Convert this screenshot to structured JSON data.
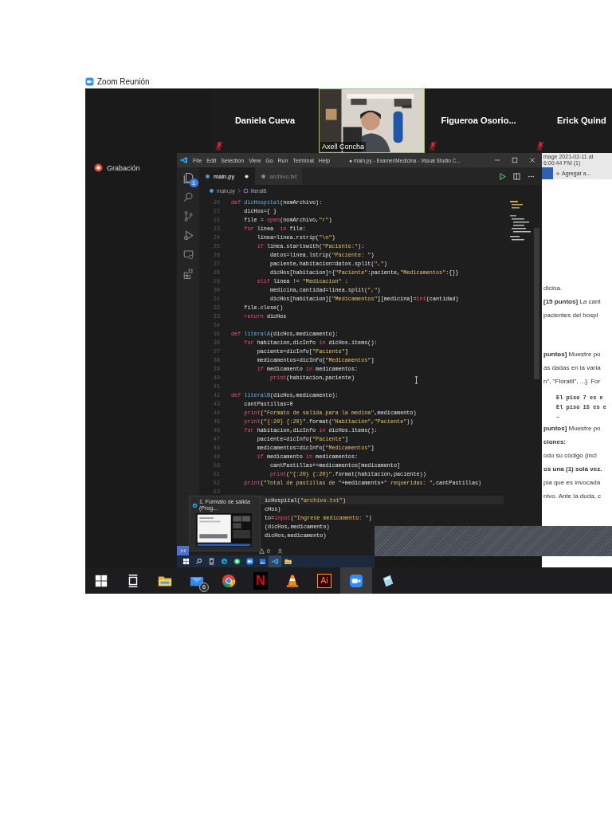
{
  "window": {
    "title": "Zoom Reunión"
  },
  "participants": [
    {
      "name": "Daniela Cueva",
      "kind": "name",
      "muted": true
    },
    {
      "name": "Axell Concha",
      "kind": "video"
    },
    {
      "name": "Figueroa  Osorio...",
      "kind": "name",
      "muted": true
    },
    {
      "name": "Erick Quind",
      "kind": "name",
      "muted": true
    }
  ],
  "recording": {
    "label": "Grabación"
  },
  "editor": {
    "menu": [
      "File",
      "Edit",
      "Selection",
      "View",
      "Go",
      "Run",
      "Terminal",
      "Help"
    ],
    "title": "● main.py - ExamenMedicina - Visual Studio C...",
    "explorer_badge": "1",
    "tabs": [
      {
        "label": "main.py",
        "selected": true,
        "modified": true
      },
      {
        "label": "archivo.txt",
        "selected": false,
        "modified": false
      }
    ],
    "breadcrumb": [
      "main.py",
      "literalB"
    ],
    "lines": [
      {
        "number": "20",
        "tokens": [
          {
            "kind": "kw",
            "text": "def "
          },
          {
            "kind": "fn",
            "text": "dicHospital"
          },
          {
            "kind": "txt",
            "text": "(nomArchivo):"
          }
        ]
      },
      {
        "number": "21",
        "tokens": [
          {
            "kind": "txt",
            "text": "    dicHos={ }"
          }
        ]
      },
      {
        "number": "22",
        "tokens": [
          {
            "kind": "txt",
            "text": "    file = "
          },
          {
            "kind": "kw",
            "text": "open"
          },
          {
            "kind": "txt",
            "text": "(nomArchivo,"
          },
          {
            "kind": "str",
            "text": "\"r\""
          },
          {
            "kind": "txt",
            "text": ")"
          }
        ]
      },
      {
        "number": "23",
        "tokens": [
          {
            "kind": "kw",
            "text": "    for "
          },
          {
            "kind": "txt",
            "text": "linea  "
          },
          {
            "kind": "kw",
            "text": "in "
          },
          {
            "kind": "txt",
            "text": "file:"
          }
        ]
      },
      {
        "number": "24",
        "tokens": [
          {
            "kind": "txt",
            "text": "        linea=linea.rstrip("
          },
          {
            "kind": "str",
            "text": "\"\\n\""
          },
          {
            "kind": "txt",
            "text": ")"
          }
        ]
      },
      {
        "number": "25",
        "tokens": [
          {
            "kind": "kw",
            "text": "        if "
          },
          {
            "kind": "txt",
            "text": "linea.startswith("
          },
          {
            "kind": "str",
            "text": "\"Paciente:\""
          },
          {
            "kind": "txt",
            "text": "):"
          }
        ]
      },
      {
        "number": "26",
        "tokens": [
          {
            "kind": "txt",
            "text": "            datos=linea.lstrip("
          },
          {
            "kind": "str",
            "text": "\"Paciente: \""
          },
          {
            "kind": "txt",
            "text": ")"
          }
        ]
      },
      {
        "number": "27",
        "tokens": [
          {
            "kind": "txt",
            "text": "            paciente,habitacion=datos.split("
          },
          {
            "kind": "str",
            "text": "\",\""
          },
          {
            "kind": "txt",
            "text": ")"
          }
        ]
      },
      {
        "number": "28",
        "tokens": [
          {
            "kind": "txt",
            "text": "            dicHos[habitacion]={"
          },
          {
            "kind": "str",
            "text": "\"Paciente\""
          },
          {
            "kind": "txt",
            "text": ":paciente,"
          },
          {
            "kind": "str",
            "text": "\"Medicamentos\""
          },
          {
            "kind": "txt",
            "text": ":{}}"
          }
        ]
      },
      {
        "number": "29",
        "tokens": [
          {
            "kind": "kw",
            "text": "        elif "
          },
          {
            "kind": "txt",
            "text": "linea != "
          },
          {
            "kind": "str",
            "text": "\"Medicacion\""
          },
          {
            "kind": "txt",
            "text": " :"
          }
        ]
      },
      {
        "number": "30",
        "tokens": [
          {
            "kind": "txt",
            "text": "            medicina,cantidad=linea.split("
          },
          {
            "kind": "str",
            "text": "\",\""
          },
          {
            "kind": "txt",
            "text": ")"
          }
        ]
      },
      {
        "number": "31",
        "tokens": [
          {
            "kind": "txt",
            "text": "            dicHos[habitacion]["
          },
          {
            "kind": "str",
            "text": "\"Medicamentos\""
          },
          {
            "kind": "txt",
            "text": "][medicina]="
          },
          {
            "kind": "kw",
            "text": "int"
          },
          {
            "kind": "txt",
            "text": "(cantidad)"
          }
        ]
      },
      {
        "number": "32",
        "tokens": [
          {
            "kind": "txt",
            "text": "    file.close()"
          }
        ]
      },
      {
        "number": "33",
        "tokens": [
          {
            "kind": "kw",
            "text": "    return "
          },
          {
            "kind": "txt",
            "text": "dicHos"
          }
        ]
      },
      {
        "number": "34"
      },
      {
        "number": "35",
        "tokens": [
          {
            "kind": "kw",
            "text": "def "
          },
          {
            "kind": "fn",
            "text": "literalA"
          },
          {
            "kind": "txt",
            "text": "(dicHos,medicamento):"
          }
        ]
      },
      {
        "number": "36",
        "tokens": [
          {
            "kind": "kw",
            "text": "    for "
          },
          {
            "kind": "txt",
            "text": "habitacion,dicInfo "
          },
          {
            "kind": "kw",
            "text": "in "
          },
          {
            "kind": "txt",
            "text": "dicHos.items():"
          }
        ]
      },
      {
        "number": "37",
        "tokens": [
          {
            "kind": "txt",
            "text": "        paciente=dicInfo["
          },
          {
            "kind": "str",
            "text": "\"Paciente\""
          },
          {
            "kind": "txt",
            "text": "]"
          }
        ]
      },
      {
        "number": "38",
        "tokens": [
          {
            "kind": "txt",
            "text": "        medicamentos=dicInfo["
          },
          {
            "kind": "str",
            "text": "\"Medicamentos\""
          },
          {
            "kind": "txt",
            "text": "]"
          }
        ]
      },
      {
        "number": "39",
        "tokens": [
          {
            "kind": "kw",
            "text": "        if "
          },
          {
            "kind": "txt",
            "text": "medicamento "
          },
          {
            "kind": "kw",
            "text": "in "
          },
          {
            "kind": "txt",
            "text": "medicamentos:"
          }
        ]
      },
      {
        "number": "40",
        "tokens": [
          {
            "kind": "kw",
            "text": "            print"
          },
          {
            "kind": "txt",
            "text": "(habitacion,paciente)"
          }
        ]
      },
      {
        "number": "41"
      },
      {
        "number": "42",
        "tokens": [
          {
            "kind": "kw",
            "text": "def "
          },
          {
            "kind": "fn",
            "text": "literalB"
          },
          {
            "kind": "txt",
            "text": "(dicHos,medicamento):"
          }
        ]
      },
      {
        "number": "43",
        "tokens": [
          {
            "kind": "txt",
            "text": "    cantPastillas=0"
          }
        ]
      },
      {
        "number": "44",
        "tokens": [
          {
            "kind": "kw",
            "text": "    print"
          },
          {
            "kind": "txt",
            "text": "("
          },
          {
            "kind": "str",
            "text": "\"Formato de salida para la medina\""
          },
          {
            "kind": "txt",
            "text": ",medicamento)"
          }
        ]
      },
      {
        "number": "45",
        "tokens": [
          {
            "kind": "kw",
            "text": "    print"
          },
          {
            "kind": "txt",
            "text": "("
          },
          {
            "kind": "str",
            "text": "\"{:20} {:20}\""
          },
          {
            "kind": "txt",
            "text": ".format("
          },
          {
            "kind": "str",
            "text": "\"Habitación\""
          },
          {
            "kind": "txt",
            "text": ","
          },
          {
            "kind": "str",
            "text": "\"Paciente\""
          },
          {
            "kind": "txt",
            "text": "))"
          }
        ]
      },
      {
        "number": "46",
        "tokens": [
          {
            "kind": "kw",
            "text": "    for "
          },
          {
            "kind": "txt",
            "text": "habitacion,dicInfo "
          },
          {
            "kind": "kw",
            "text": "in "
          },
          {
            "kind": "txt",
            "text": "dicHos.items():"
          }
        ]
      },
      {
        "number": "47",
        "tokens": [
          {
            "kind": "txt",
            "text": "        paciente=dicInfo["
          },
          {
            "kind": "str",
            "text": "\"Paciente\""
          },
          {
            "kind": "txt",
            "text": "]"
          }
        ]
      },
      {
        "number": "48",
        "tokens": [
          {
            "kind": "txt",
            "text": "        medicamentos=dicInfo["
          },
          {
            "kind": "str",
            "text": "\"Medicamentos\""
          },
          {
            "kind": "txt",
            "text": "]"
          }
        ]
      },
      {
        "number": "49",
        "tokens": [
          {
            "kind": "kw",
            "text": "        if "
          },
          {
            "kind": "txt",
            "text": "medicamento "
          },
          {
            "kind": "kw",
            "text": "in "
          },
          {
            "kind": "txt",
            "text": "medicamentos:"
          }
        ]
      },
      {
        "number": "50",
        "tokens": [
          {
            "kind": "txt",
            "text": "            cantPastillas+=medicamentos[medicamento]"
          }
        ]
      },
      {
        "number": "51",
        "tokens": [
          {
            "kind": "kw",
            "text": "            print"
          },
          {
            "kind": "txt",
            "text": "("
          },
          {
            "kind": "str",
            "text": "\"{:20} {:20}\""
          },
          {
            "kind": "txt",
            "text": ".format(habitacion,paciente))"
          }
        ]
      },
      {
        "number": "52",
        "tokens": [
          {
            "kind": "kw",
            "text": "    print"
          },
          {
            "kind": "txt",
            "text": "("
          },
          {
            "kind": "str",
            "text": "\"Total de pastillas de \""
          },
          {
            "kind": "txt",
            "text": "+medicamento+"
          },
          {
            "kind": "str",
            "text": "\" requeridas: \""
          },
          {
            "kind": "txt",
            "text": ",cantPastillas)"
          }
        ]
      },
      {
        "number": "53"
      }
    ],
    "covered_lines": [
      {
        "current": true,
        "tokens": [
          {
            "kind": "txt",
            "text": "icHospital("
          },
          {
            "kind": "str",
            "text": "\"archivo.txt\""
          },
          {
            "kind": "txt",
            "text": ")"
          }
        ]
      },
      {
        "current": false,
        "tokens": [
          {
            "kind": "txt",
            "text": "cHos)"
          }
        ]
      },
      {
        "current": false,
        "tokens": [
          {
            "kind": "txt",
            "text": "to="
          },
          {
            "kind": "kw",
            "text": "input"
          },
          {
            "kind": "txt",
            "text": "("
          },
          {
            "kind": "str",
            "text": "\"Ingrese medicamento: \""
          },
          {
            "kind": "txt",
            "text": ")"
          }
        ]
      },
      {
        "current": false,
        "tokens": [
          {
            "kind": "txt",
            "text": "(dicHos,medicamento)"
          }
        ]
      },
      {
        "current": false,
        "tokens": [
          {
            "kind": "txt",
            "text": "dicHos,medicamento)"
          }
        ]
      }
    ],
    "warnings": "0",
    "preview_title": "1. Formato de salida (Prog..."
  },
  "inner_taskbar": [
    {
      "kind": "windows",
      "active": false
    },
    {
      "kind": "search",
      "active": false
    },
    {
      "kind": "taskview",
      "active": false
    },
    {
      "kind": "edge",
      "active": false
    },
    {
      "kind": "whatsapp",
      "active": false
    },
    {
      "kind": "zoom",
      "active": false
    },
    {
      "kind": "photos",
      "active": false
    },
    {
      "kind": "vscode",
      "active": true
    },
    {
      "kind": "explorer",
      "active": false
    }
  ],
  "document": {
    "file_tab": "mage 2021-02-11 at 6:00:44 PM (1)",
    "add_label": "Agregar a...",
    "sections": [
      [
        {
          "kind": "text",
          "text": "dicina."
        },
        {
          "kind": "text",
          "text": "**[15 puntos]** La cant"
        },
        {
          "kind": "text",
          "text": "pacientes del hospi"
        }
      ],
      [
        {
          "kind": "text",
          "text": "**puntos]** Muestre po"
        },
        {
          "kind": "text",
          "text": "as dadas en la varia"
        },
        {
          "kind": "text",
          "text": "n\", \"Floratil\", ...]. For"
        },
        {
          "kind": "mono",
          "text": "El piso 7 es e"
        },
        {
          "kind": "mono",
          "text": "El piso 15 es e"
        },
        {
          "kind": "mono",
          "text": "–"
        },
        {
          "kind": "text",
          "text": "**puntos]** Muestre po"
        }
      ],
      [
        {
          "kind": "heading",
          "text": "ciones:"
        },
        {
          "kind": "text",
          "text": "odo su código (incl"
        },
        {
          "kind": "text",
          "text": "**os una (1) sola vez.**"
        },
        {
          "kind": "text",
          "text": "pia que es invocada"
        },
        {
          "kind": "text",
          "text": "nivo. Ante la duda, c"
        }
      ]
    ]
  },
  "taskbar": [
    {
      "kind": "windows",
      "active": false
    },
    {
      "kind": "taskview",
      "active": false
    },
    {
      "kind": "explorer",
      "active": false
    },
    {
      "kind": "mail",
      "active": false,
      "badge": "6"
    },
    {
      "kind": "chrome",
      "active": false
    },
    {
      "kind": "netflix",
      "active": false,
      "label": "N"
    },
    {
      "kind": "vlc",
      "active": false
    },
    {
      "kind": "illustrator",
      "active": false,
      "label": "Ai"
    },
    {
      "kind": "zoom",
      "active": true
    },
    {
      "kind": "notes",
      "active": false
    }
  ]
}
